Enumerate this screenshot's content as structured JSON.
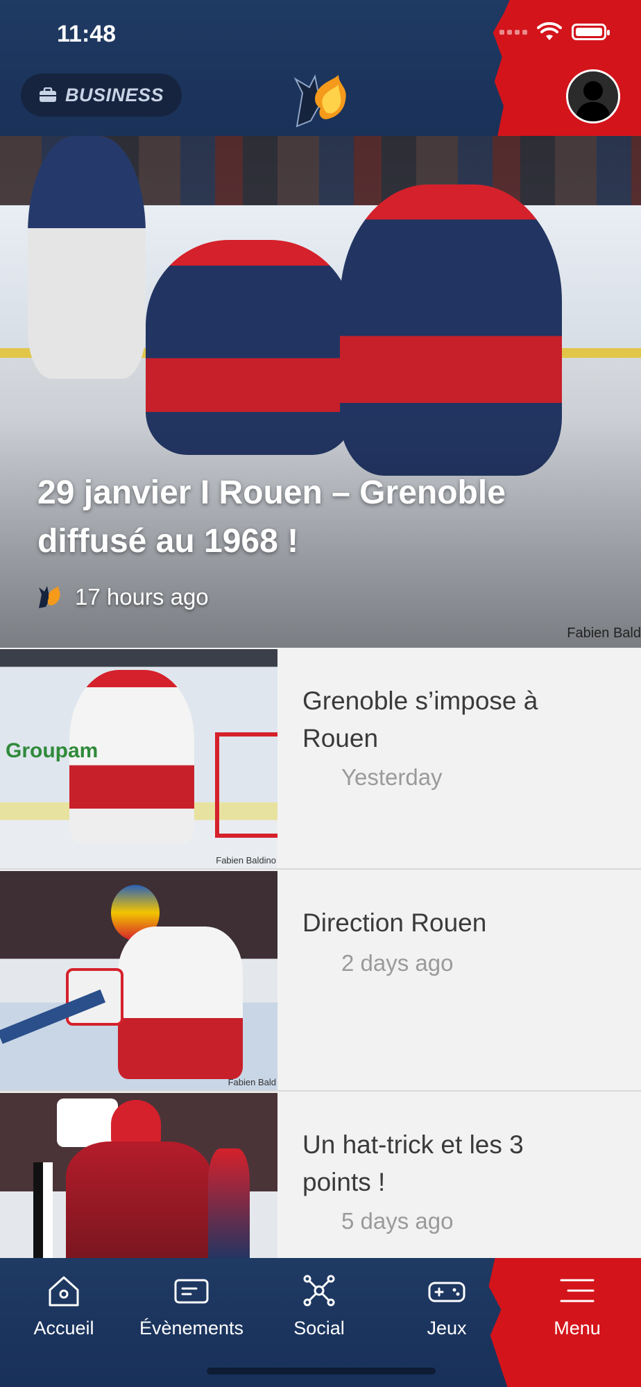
{
  "status_bar": {
    "time": "11:48"
  },
  "header": {
    "business_label": "BUSINESS"
  },
  "hero": {
    "title": "29 janvier I Rouen – Grenoble diffusé au 1968 !",
    "time": "17 hours ago",
    "credit": "Fabien Bald"
  },
  "articles": [
    {
      "title": "Grenoble s’impose à Rouen",
      "time": "Yesterday",
      "credit": "Fabien Baldino"
    },
    {
      "title": "Direction Rouen",
      "time": "2 days ago",
      "credit": "Fabien Bald"
    },
    {
      "title": "Un hat-trick et les 3 points !",
      "time": "5 days ago"
    }
  ],
  "tabs": [
    {
      "label": "Accueil",
      "icon": "home-icon"
    },
    {
      "label": "Évènements",
      "icon": "events-icon"
    },
    {
      "label": "Social",
      "icon": "social-network-icon"
    },
    {
      "label": "Jeux",
      "icon": "gamepad-icon"
    },
    {
      "label": "Menu",
      "icon": "menu-icon"
    }
  ],
  "colors": {
    "navy": "#1f3a63",
    "red": "#d4141b",
    "list_bg": "#f2f2f2",
    "text": "#3a3a3a",
    "muted": "#9a9a9a"
  }
}
